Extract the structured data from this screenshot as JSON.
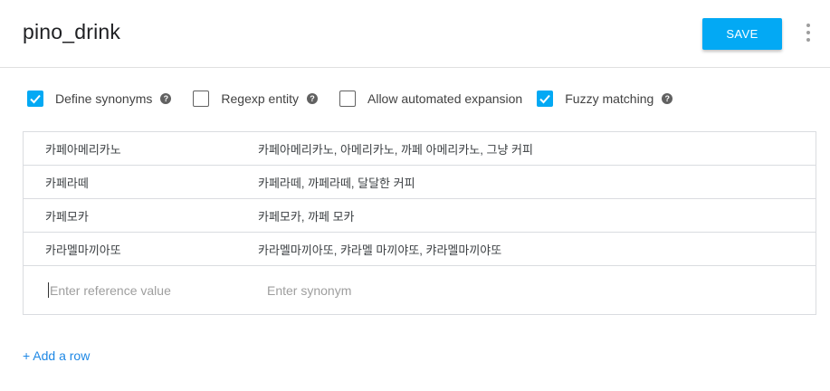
{
  "header": {
    "title": "pino_drink",
    "save_label": "SAVE",
    "menu_icon": "more-vert-icon"
  },
  "options": [
    {
      "label": "Define synonyms",
      "checked": true,
      "help": true
    },
    {
      "label": "Regexp entity",
      "checked": false,
      "help": true
    },
    {
      "label": "Allow automated expansion",
      "checked": false,
      "help": false
    },
    {
      "label": "Fuzzy matching",
      "checked": true,
      "help": true
    }
  ],
  "rows": [
    {
      "reference": "카페아메리카노",
      "synonyms": "카페아메리카노, 아메리카노, 까페 아메리카노, 그냥 커피"
    },
    {
      "reference": "카페라떼",
      "synonyms": "카페라떼, 까페라떼, 달달한 커피"
    },
    {
      "reference": "카페모카",
      "synonyms": "카페모카, 까페 모카"
    },
    {
      "reference": "카라멜마끼아또",
      "synonyms": "카라멜마끼아또, 캬라멜 마끼야또, 캬라멜마끼야또"
    }
  ],
  "new_row": {
    "reference_placeholder": "Enter reference value",
    "synonym_placeholder": "Enter synonym"
  },
  "add_row_label": "+ Add a row",
  "colors": {
    "accent": "#03a9f4",
    "link": "#1e88e5"
  }
}
